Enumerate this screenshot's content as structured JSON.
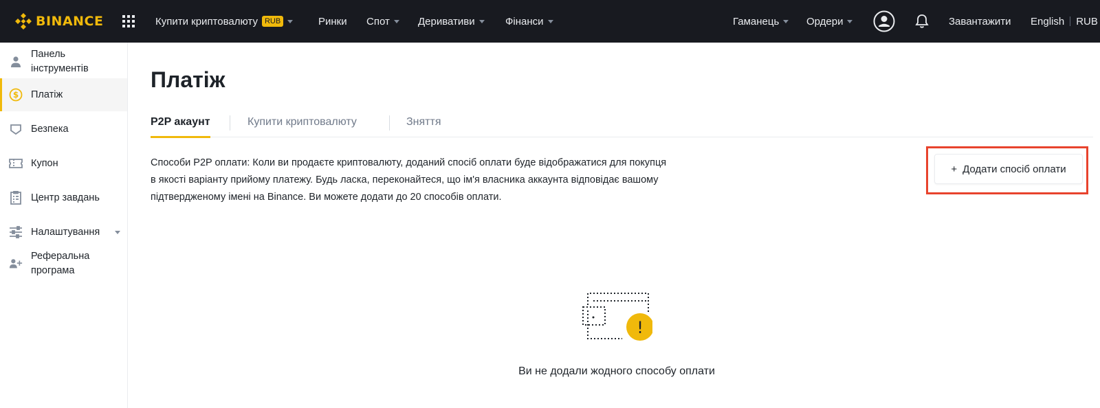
{
  "header": {
    "logo_text": "BINANCE",
    "nav": [
      {
        "label": "Купити криптовалюту",
        "badge": "RUB",
        "has_caret": true
      },
      {
        "label": "Ринки",
        "has_caret": false
      },
      {
        "label": "Спот",
        "has_caret": true
      },
      {
        "label": "Деривативи",
        "has_caret": true
      },
      {
        "label": "Фінанси",
        "has_caret": true
      }
    ],
    "wallet_label": "Гаманець",
    "orders_label": "Ордери",
    "download_label": "Завантажити",
    "language_label": "English",
    "currency_label": "RUB"
  },
  "sidebar": {
    "items": [
      {
        "line1": "Панель",
        "line2": "інструментів",
        "icon": "user-icon"
      },
      {
        "line1": "Платіж",
        "icon": "dollar-circle-icon",
        "active": true
      },
      {
        "line1": "Безпека",
        "icon": "shield-icon"
      },
      {
        "line1": "Купон",
        "icon": "ticket-icon"
      },
      {
        "line1": "Центр завдань",
        "icon": "clipboard-icon"
      },
      {
        "line1": "Налаштування",
        "icon": "sliders-icon",
        "has_caret": true
      },
      {
        "line1": "Реферальна",
        "line2": "програма",
        "icon": "user-plus-icon"
      }
    ]
  },
  "main": {
    "title": "Платіж",
    "tabs": [
      {
        "label": "P2P акаунт",
        "active": true
      },
      {
        "label": "Купити криптовалюту"
      },
      {
        "label": "Зняття"
      }
    ],
    "description_lines": [
      "Способи P2P оплати: Коли ви продаєте криптовалюту, доданий спосіб оплати буде відображатися для покупця",
      "в якості варіанту прийому платежу. Будь ласка, переконайтеся, що ім'я власника аккаунта відповідає вашому",
      "підтвердженому імені на Binance. Ви можете додати до 20 способів оплати."
    ],
    "add_button": {
      "plus": "+",
      "label": "Додати спосіб оплати"
    },
    "empty_state": {
      "message": "Ви не додали жодного способу оплати",
      "icon": "empty-wallet-icon",
      "alert_mark": "!"
    }
  },
  "colors": {
    "brand": "#f0b90b",
    "topbar_bg": "#181a20",
    "highlight_border": "#e8432d"
  }
}
